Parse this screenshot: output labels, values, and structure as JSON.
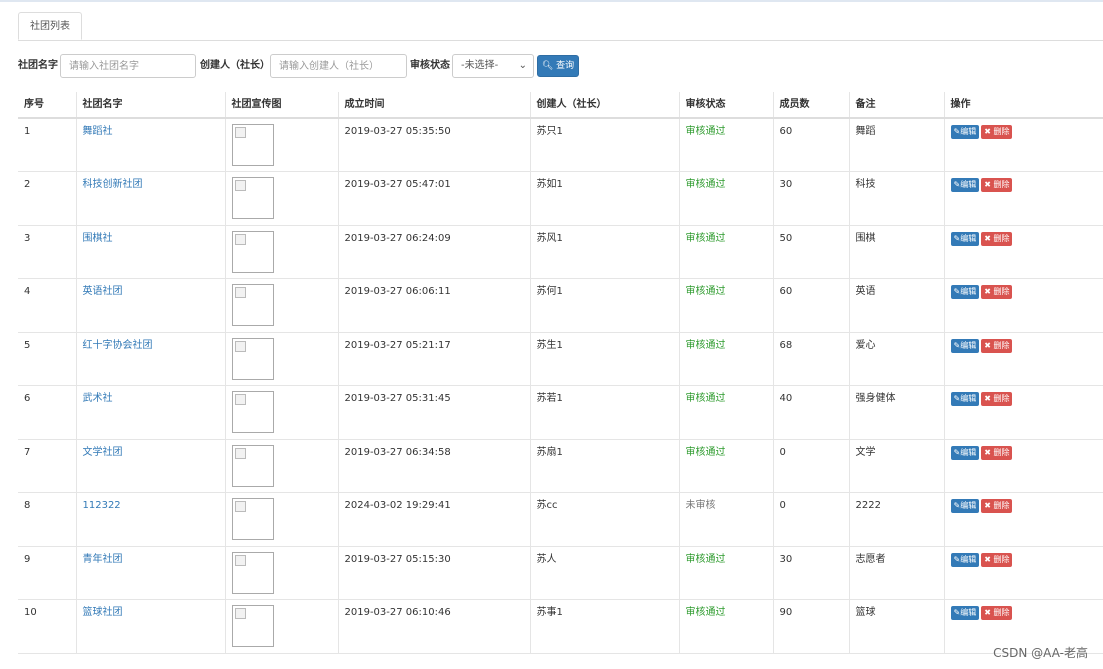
{
  "tabs": [
    "社团列表"
  ],
  "search": {
    "name_label": "社团名字",
    "name_placeholder": "请输入社团名字",
    "creator_label": "创建人（社长）",
    "creator_placeholder": "请输入创建人（社长）",
    "status_label": "审核状态",
    "status_selected": "-未选择-",
    "query_label": "查询"
  },
  "table": {
    "headers": [
      "序号",
      "社团名字",
      "社团宣传图",
      "成立时间",
      "创建人（社长）",
      "审核状态",
      "成员数",
      "备注",
      "操作"
    ],
    "edit_label": "编辑",
    "delete_label": "删除",
    "rows": [
      {
        "no": "1",
        "name": "舞蹈社",
        "time": "2019-03-27 05:35:50",
        "creator": "苏只1",
        "status": "审核通过",
        "members": "60",
        "note": "舞蹈"
      },
      {
        "no": "2",
        "name": "科技创新社团",
        "time": "2019-03-27 05:47:01",
        "creator": "苏如1",
        "status": "审核通过",
        "members": "30",
        "note": "科技"
      },
      {
        "no": "3",
        "name": "围棋社",
        "time": "2019-03-27 06:24:09",
        "creator": "苏风1",
        "status": "审核通过",
        "members": "50",
        "note": "围棋"
      },
      {
        "no": "4",
        "name": "英语社团",
        "time": "2019-03-27 06:06:11",
        "creator": "苏何1",
        "status": "审核通过",
        "members": "60",
        "note": "英语"
      },
      {
        "no": "5",
        "name": "红十字协会社团",
        "time": "2019-03-27 05:21:17",
        "creator": "苏生1",
        "status": "审核通过",
        "members": "68",
        "note": "爱心"
      },
      {
        "no": "6",
        "name": "武术社",
        "time": "2019-03-27 05:31:45",
        "creator": "苏若1",
        "status": "审核通过",
        "members": "40",
        "note": "强身健体"
      },
      {
        "no": "7",
        "name": "文学社团",
        "time": "2019-03-27 06:34:58",
        "creator": "苏扇1",
        "status": "审核通过",
        "members": "0",
        "note": "文学"
      },
      {
        "no": "8",
        "name": "112322",
        "time": "2024-03-02 19:29:41",
        "creator": "苏cc",
        "status": "未审核",
        "members": "0",
        "note": "2222"
      },
      {
        "no": "9",
        "name": "青年社团",
        "time": "2019-03-27 05:15:30",
        "creator": "苏人",
        "status": "审核通过",
        "members": "30",
        "note": "志愿者"
      },
      {
        "no": "10",
        "name": "篮球社团",
        "time": "2019-03-27 06:10:46",
        "creator": "苏事1",
        "status": "审核通过",
        "members": "90",
        "note": "篮球"
      }
    ]
  },
  "watermark": "CSDN @AA-老高",
  "colors": {
    "primary": "#337ab7",
    "danger": "#d9534f",
    "approved": "#2e9b2e",
    "pending": "#777777"
  }
}
